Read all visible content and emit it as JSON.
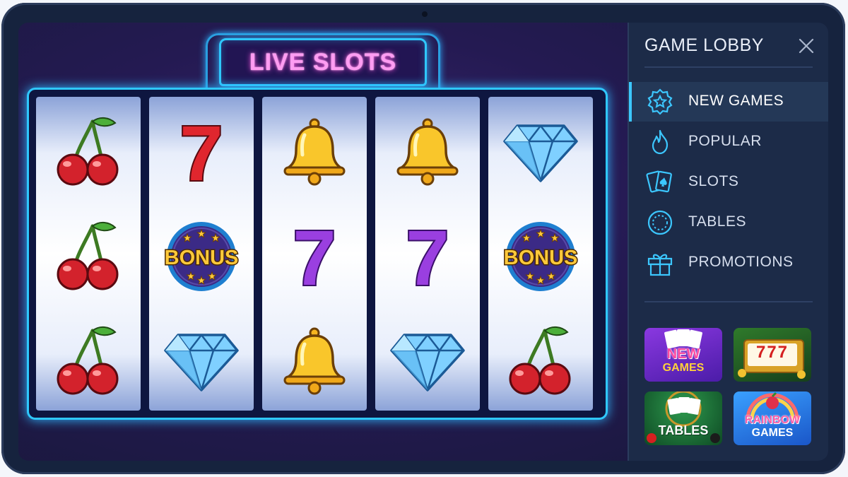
{
  "slots": {
    "title": "LIVE SLOTS",
    "reels": [
      [
        "cherry",
        "cherry",
        "cherry"
      ],
      [
        "seven-red",
        "bonus",
        "diamond"
      ],
      [
        "bell",
        "seven-purple",
        "bell"
      ],
      [
        "bell",
        "seven-purple",
        "diamond"
      ],
      [
        "diamond",
        "bonus",
        "cherry"
      ]
    ],
    "bonus_label": "BONUS",
    "seven_label": "7"
  },
  "lobby": {
    "title": "GAME LOBBY",
    "menu": [
      {
        "label": "NEW GAMES",
        "icon": "star-badge-icon",
        "active": true
      },
      {
        "label": "POPULAR",
        "icon": "flame-icon",
        "active": false
      },
      {
        "label": "SLOTS",
        "icon": "cards-icon",
        "active": false
      },
      {
        "label": "TABLES",
        "icon": "roulette-icon",
        "active": false
      },
      {
        "label": "PROMOTIONS",
        "icon": "gift-icon",
        "active": false
      }
    ],
    "tiles": [
      {
        "line1": "NEW",
        "line2": "GAMES"
      },
      {
        "line1": "777",
        "line2": ""
      },
      {
        "line1": "TABLES",
        "line2": ""
      },
      {
        "line1": "RAINBOW",
        "line2": "GAMES"
      }
    ]
  },
  "colors": {
    "accent": "#2fc8ff",
    "title_glow": "#ff9cf2",
    "panel": "#1c2b48"
  }
}
